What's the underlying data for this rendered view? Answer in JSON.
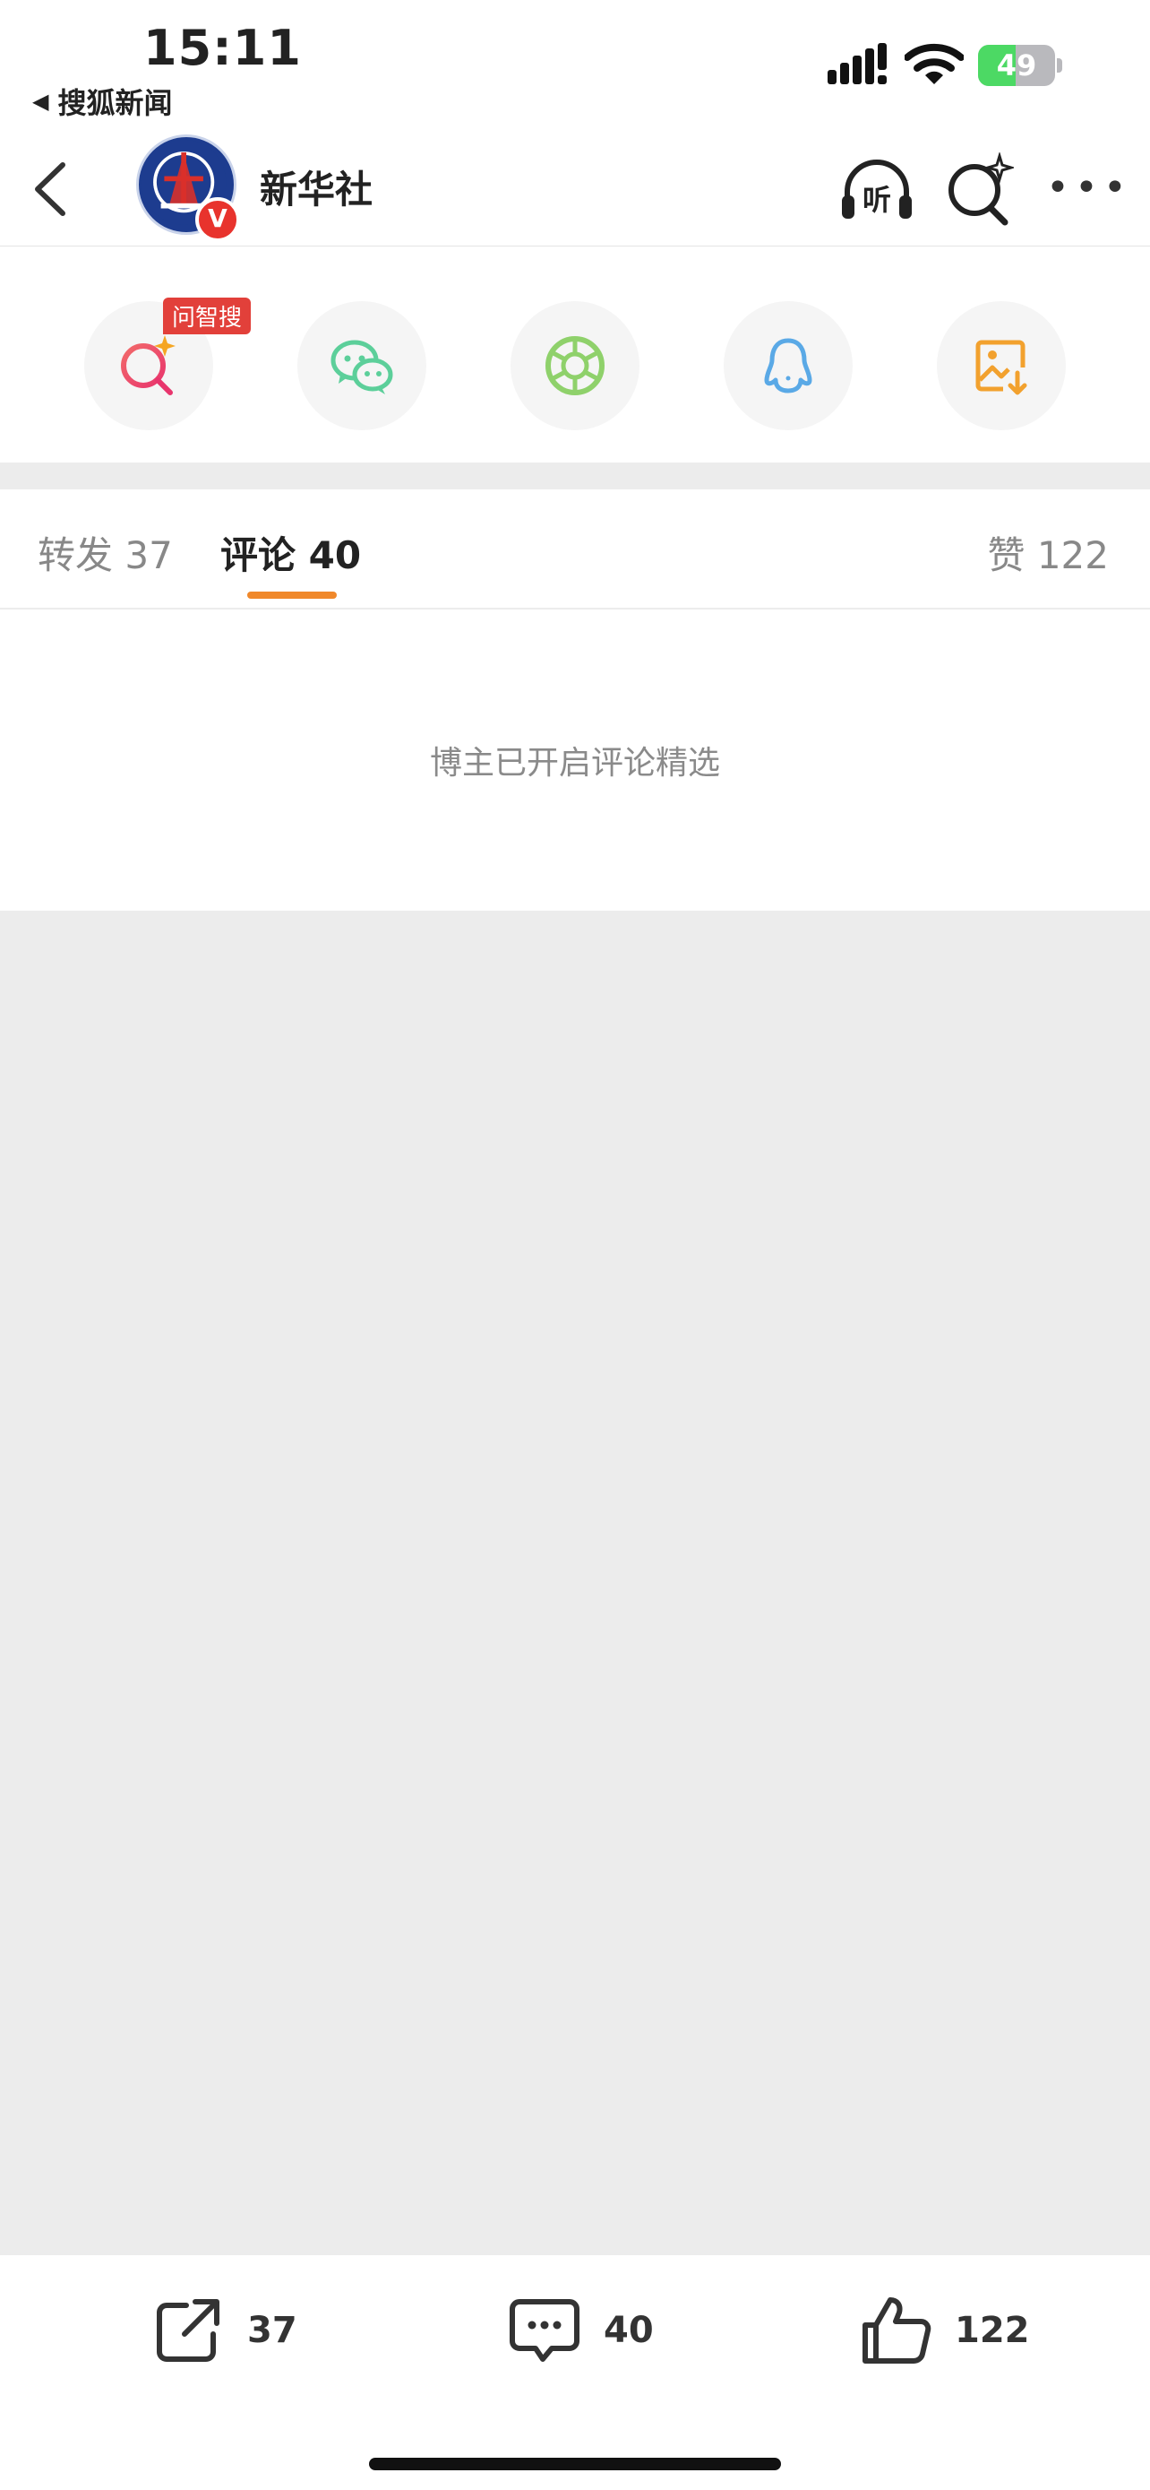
{
  "status_bar": {
    "time": "15:11",
    "back_app_label": "搜狐新闻",
    "battery_percent": "49",
    "battery_level": 0.49
  },
  "nav": {
    "title": "新华社",
    "avatar_badge": "V",
    "listen_label": "听",
    "more_label": "•••"
  },
  "share": {
    "zhisou_tag": "问智搜",
    "icons": [
      "ai-search-icon",
      "wechat-icon",
      "moments-icon",
      "qq-icon",
      "save-image-icon"
    ]
  },
  "tabs": {
    "repost": "转发 37",
    "comment": "评论 40",
    "like": "赞 122"
  },
  "comments": {
    "empty_message": "博主已开启评论精选"
  },
  "actions": {
    "repost_count": "37",
    "comment_count": "40",
    "like_count": "122"
  },
  "colors": {
    "accent_orange": "#f0882a",
    "tag_red": "#e2403a",
    "wechat_green": "#5ccf9a",
    "moments_green": "#8fd16b",
    "qq_blue": "#5aa9e6",
    "save_orange": "#f2a12e",
    "battery_green": "#4cd964"
  }
}
